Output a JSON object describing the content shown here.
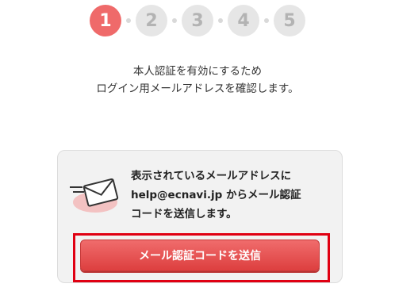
{
  "steps": {
    "items": [
      "1",
      "2",
      "3",
      "4",
      "5"
    ],
    "active_index": 1
  },
  "intro": {
    "line1": "本人認証を有効にするため",
    "line2": "ログイン用メールアドレスを確認します。"
  },
  "card": {
    "icon": "envelope-icon",
    "message_line1": "表示されているメールアドレスに",
    "message_line2": "help@ecnavi.jp からメール認証",
    "message_line3": "コードを送信します。",
    "send_button_label": "メール認証コードを送信"
  },
  "colors": {
    "accent": "#ef6a6a",
    "button": "#e04848",
    "highlight": "#e00012",
    "step_inactive": "#e6e6e6"
  }
}
